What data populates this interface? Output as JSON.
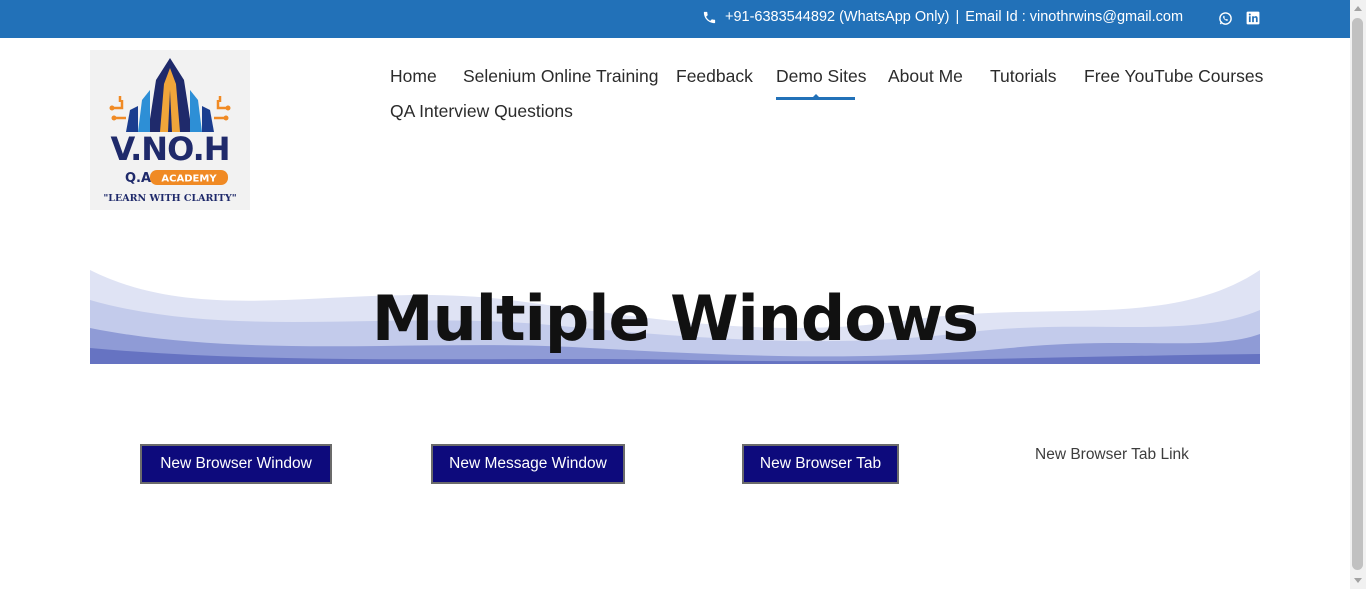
{
  "topbar": {
    "phone": "+91-6383544892 (WhatsApp Only)",
    "separator": "|",
    "email": "Email Id : vinothrwins@gmail.com",
    "icons": [
      "phone-icon",
      "whatsapp-icon",
      "linkedin-icon"
    ],
    "background_color": "#2271b8"
  },
  "logo": {
    "brand": "V.NO.H",
    "line2": "Q.A ACADEMY",
    "tagline": "\"LEARN WITH CLARITY\""
  },
  "nav": {
    "items": [
      {
        "label": "Home"
      },
      {
        "label": "Selenium Online Training"
      },
      {
        "label": "Feedback"
      },
      {
        "label": "Demo Sites"
      },
      {
        "label": "About Me"
      },
      {
        "label": "Tutorials"
      },
      {
        "label": "Free YouTube Courses"
      },
      {
        "label": "QA Interview Questions"
      }
    ],
    "active": "Demo Sites",
    "accent_color": "#2271b8"
  },
  "banner": {
    "title": "Multiple Windows"
  },
  "actions": {
    "new_browser_window": "New Browser Window",
    "new_message_window": "New Message Window",
    "new_browser_tab": "New Browser Tab",
    "new_browser_tab_link": "New Browser Tab Link",
    "button_color": "#0d0a7c"
  }
}
